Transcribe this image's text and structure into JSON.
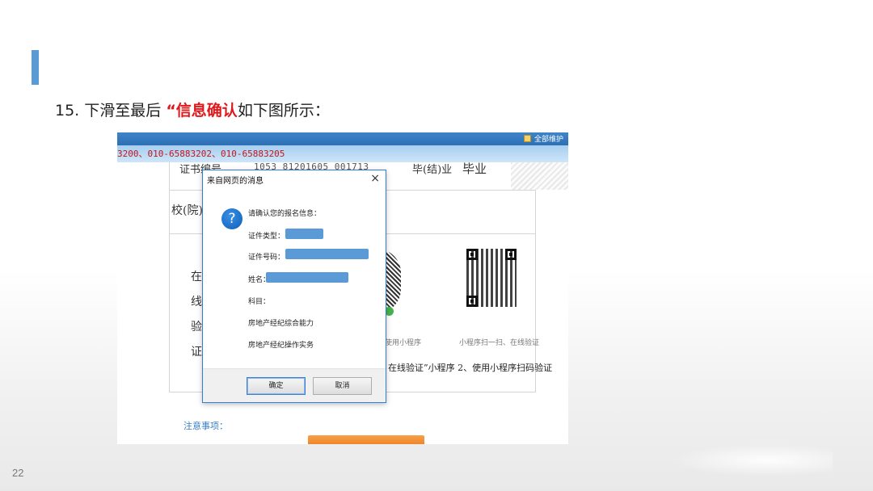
{
  "slide": {
    "title_prefix": "15. 下滑至最后",
    "title_highlight": "“信息确认",
    "title_suffix": "如下图所示：",
    "page_number": "22",
    "accent_color": "#5b9bd5",
    "highlight_color": "#e0181c"
  },
  "screenshot": {
    "top_user_label": "全部维护",
    "phone_bar": "3200、010-65883202、010-65883205",
    "cert_label": "证书编号",
    "cert_value": "1053 81201605 001713",
    "grad_label": "毕(结)业",
    "grad_value": "毕业",
    "principal_label": "校(院)长",
    "verify_chars": [
      "在",
      "线",
      "验",
      "证"
    ],
    "qr_left_caption": "使用小程序",
    "qr_right_caption": "小程序扫一扫、在线验证",
    "step_line": "在线验证”小程序   2、使用小程序扫码验证",
    "notice_label": "注意事项：",
    "brand_color": "#2e6fb4"
  },
  "dialog": {
    "title": "来自网页的消息",
    "close_glyph": "×",
    "icon_glyph": "?",
    "prompt": "请确认您的报名信息：",
    "id_type_label": "证件类型：",
    "id_number_label": "证件号码：",
    "name_label": "姓名：",
    "subject_label": "科目：",
    "subjects": [
      "房地产经纪综合能力",
      "房地产经纪操作实务"
    ],
    "ok_label": "确定",
    "cancel_label": "取消",
    "mask_color": "#5a9ad6"
  }
}
